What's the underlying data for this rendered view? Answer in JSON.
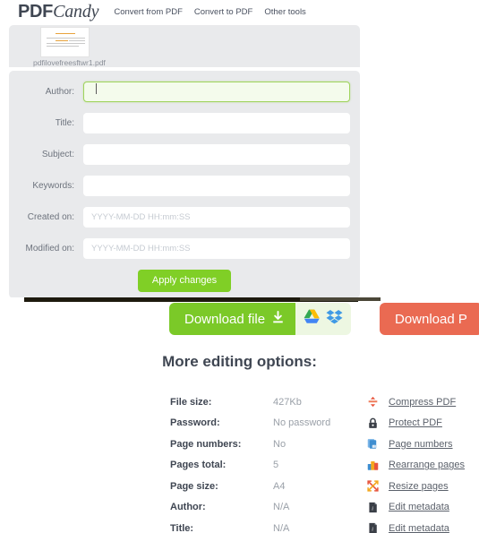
{
  "header": {
    "logo_primary": "PDF",
    "logo_secondary": "Candy",
    "nav": [
      {
        "label": "Convert from PDF",
        "name": "nav-convert-from-pdf"
      },
      {
        "label": "Convert to PDF",
        "name": "nav-convert-to-pdf"
      },
      {
        "label": "Other tools",
        "name": "nav-other-tools"
      }
    ]
  },
  "file": {
    "name": "pdfilovefreesftwr1.pdf"
  },
  "metadata_form": {
    "fields": [
      {
        "label": "Author:",
        "value": "",
        "placeholder": "",
        "focused": true,
        "name": "author"
      },
      {
        "label": "Title:",
        "value": "",
        "placeholder": "",
        "focused": false,
        "name": "title"
      },
      {
        "label": "Subject:",
        "value": "",
        "placeholder": "",
        "focused": false,
        "name": "subject"
      },
      {
        "label": "Keywords:",
        "value": "",
        "placeholder": "",
        "focused": false,
        "name": "keywords"
      },
      {
        "label": "Created on:",
        "value": "",
        "placeholder": "YYYY-MM-DD HH:mm:SS",
        "focused": false,
        "name": "created-on"
      },
      {
        "label": "Modified on:",
        "value": "",
        "placeholder": "YYYY-MM-DD HH:mm:SS",
        "focused": false,
        "name": "modified-on"
      }
    ],
    "apply_label": "Apply changes"
  },
  "downloads": {
    "primary_label": "Download file",
    "primary_icon": "download-icon",
    "cloud_icons": [
      "google-drive-icon",
      "dropbox-icon"
    ],
    "secondary_label": "Download P"
  },
  "more_options": {
    "title": "More editing options:",
    "rows": [
      {
        "key": "File size:",
        "value": "427Kb",
        "link": "Compress PDF",
        "icon": "compress-icon"
      },
      {
        "key": "Password:",
        "value": "No password",
        "link": "Protect PDF",
        "icon": "lock-icon"
      },
      {
        "key": "Page numbers:",
        "value": "No",
        "link": "Page numbers",
        "icon": "page-numbers-icon"
      },
      {
        "key": "Pages total:",
        "value": "5",
        "link": "Rearrange pages",
        "icon": "rearrange-icon"
      },
      {
        "key": "Page size:",
        "value": "A4",
        "link": "Resize pages",
        "icon": "resize-icon"
      },
      {
        "key": "Author:",
        "value": "N/A",
        "link": "Edit metadata",
        "icon": "metadata-icon"
      },
      {
        "key": "Title:",
        "value": "N/A",
        "link": "Edit metadata",
        "icon": "metadata-icon"
      }
    ]
  },
  "colors": {
    "green": "#7bc928",
    "red": "#ea6a52",
    "panel": "#e9eaec",
    "text": "#3f4652"
  }
}
